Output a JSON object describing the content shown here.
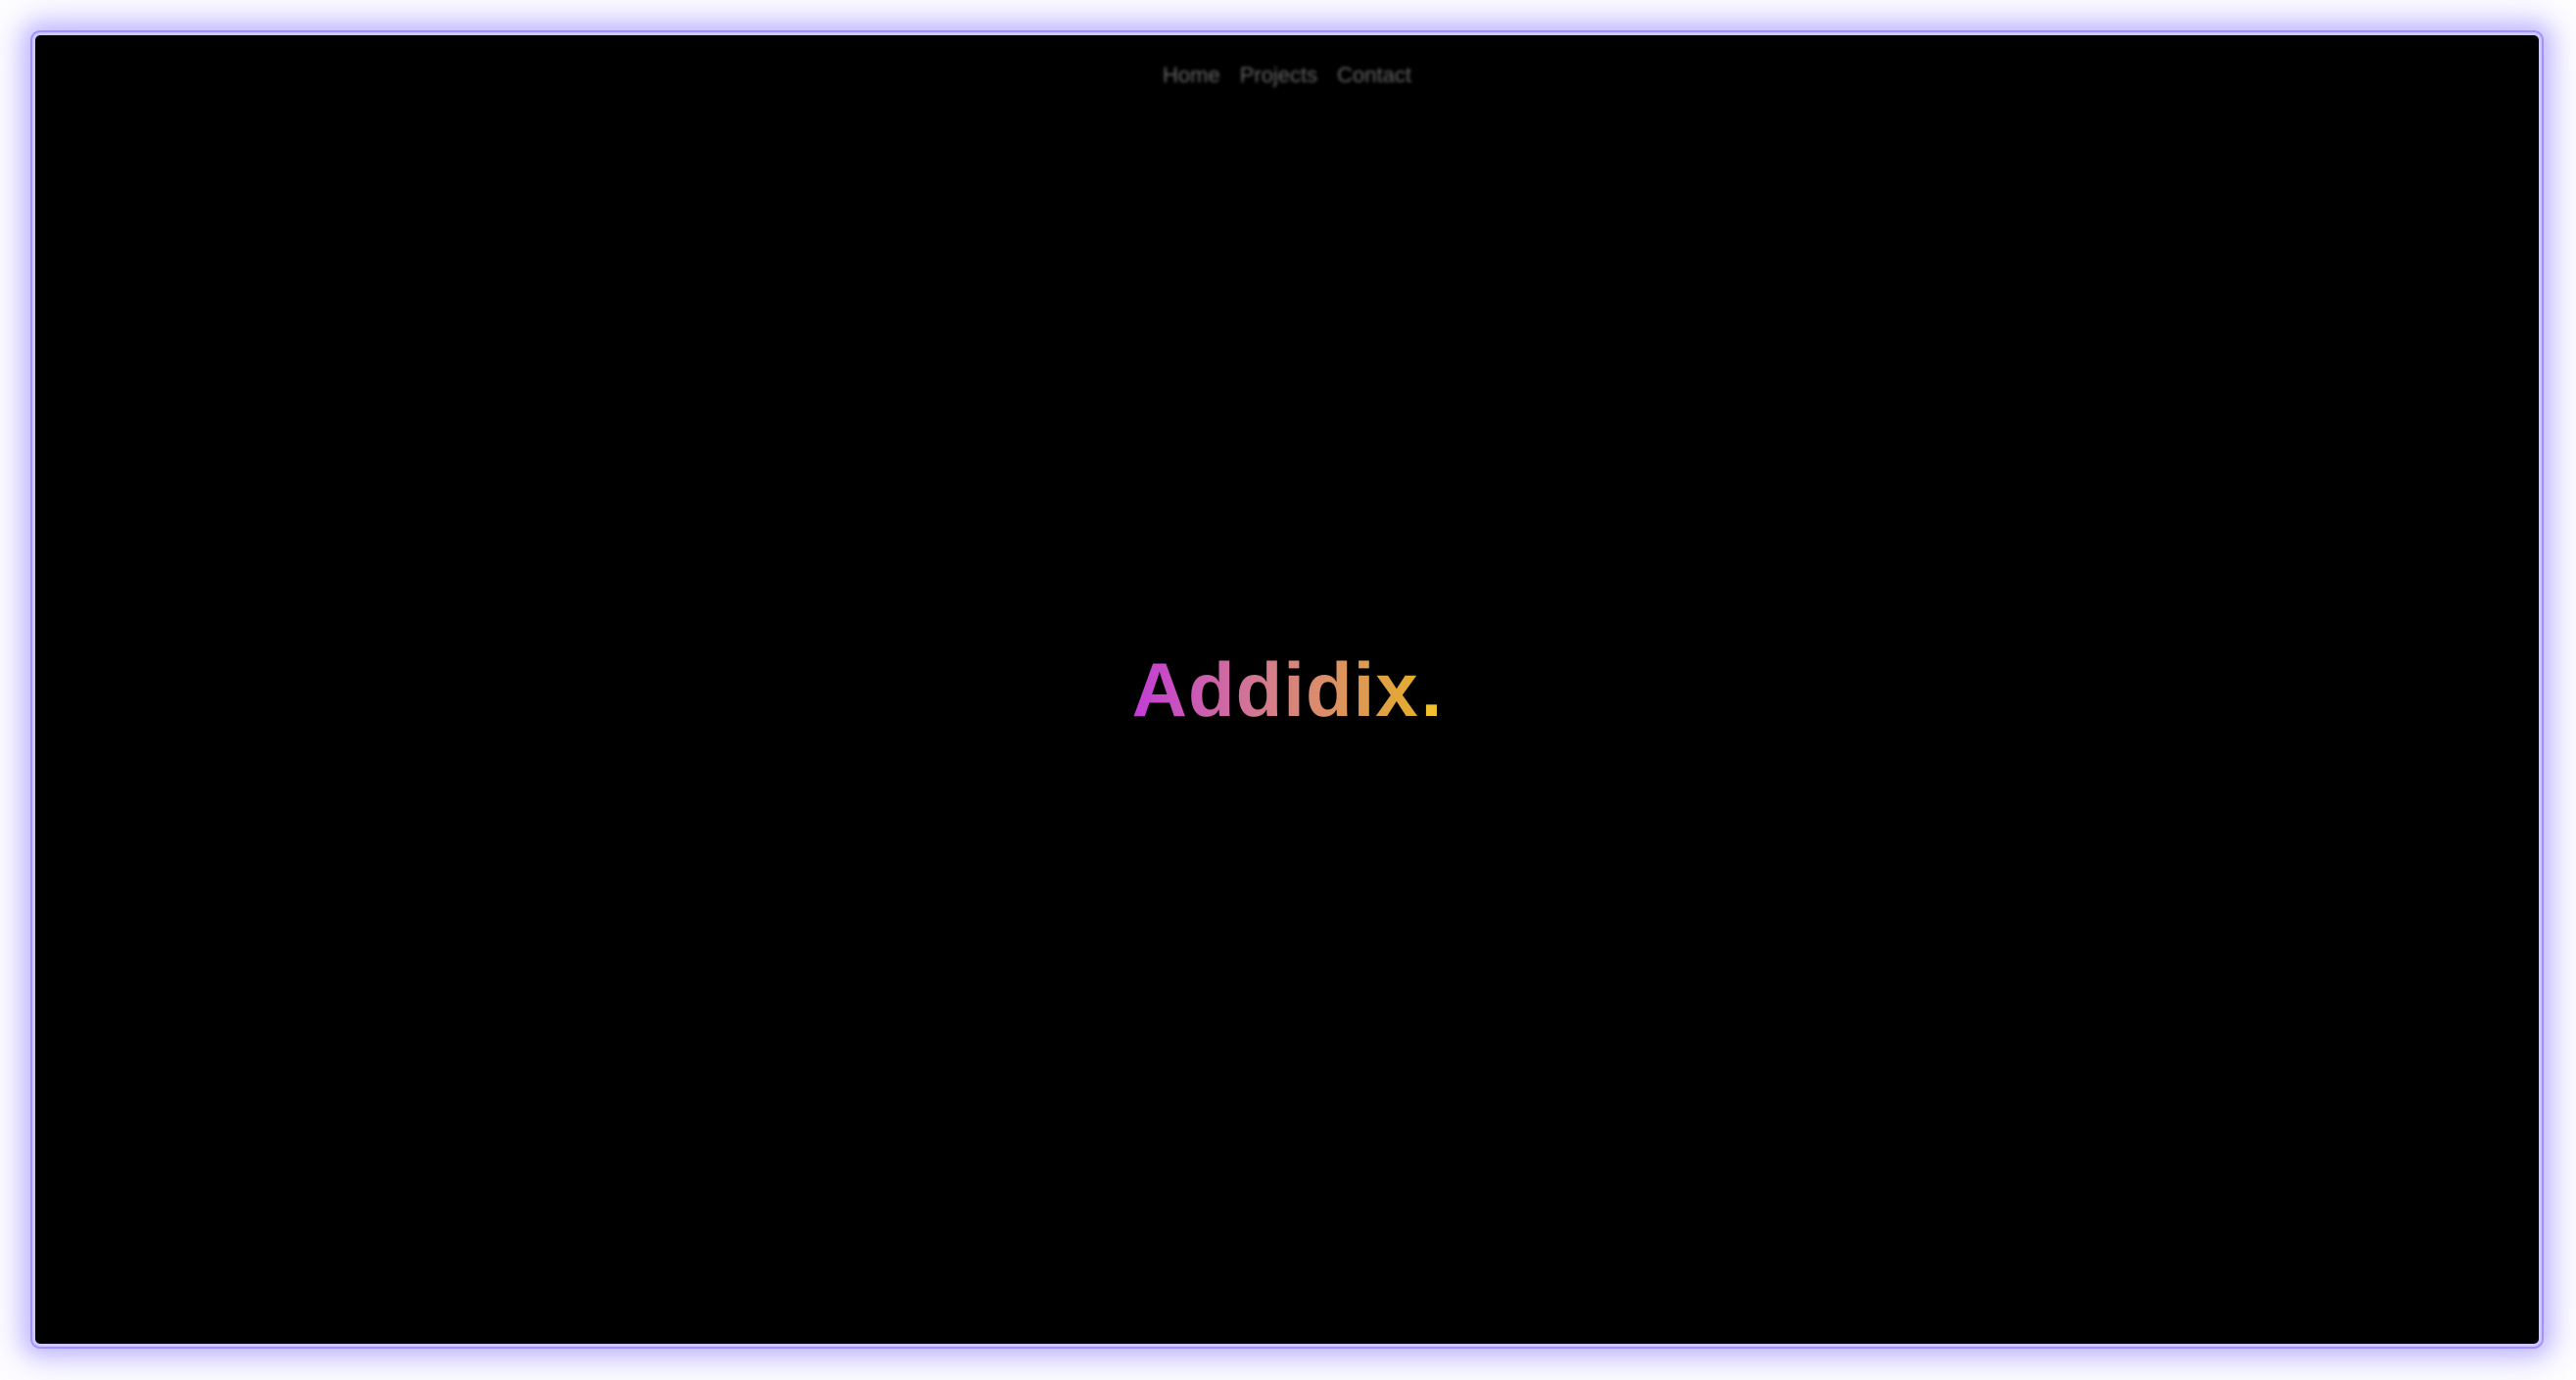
{
  "nav": {
    "links": [
      {
        "label": "Home"
      },
      {
        "label": "Projects"
      },
      {
        "label": "Contact"
      }
    ]
  },
  "hero": {
    "brand": "Addidix",
    "dot": "."
  },
  "colors": {
    "background": "#000000",
    "frame_glow": "#6e5aff",
    "brand_gradient_start": "#c23cd7",
    "brand_gradient_mid": "#d47a8f",
    "brand_gradient_end": "#e4ad2e",
    "brand_dot": "#f0c02d",
    "nav_text": "#b7b7b7"
  }
}
